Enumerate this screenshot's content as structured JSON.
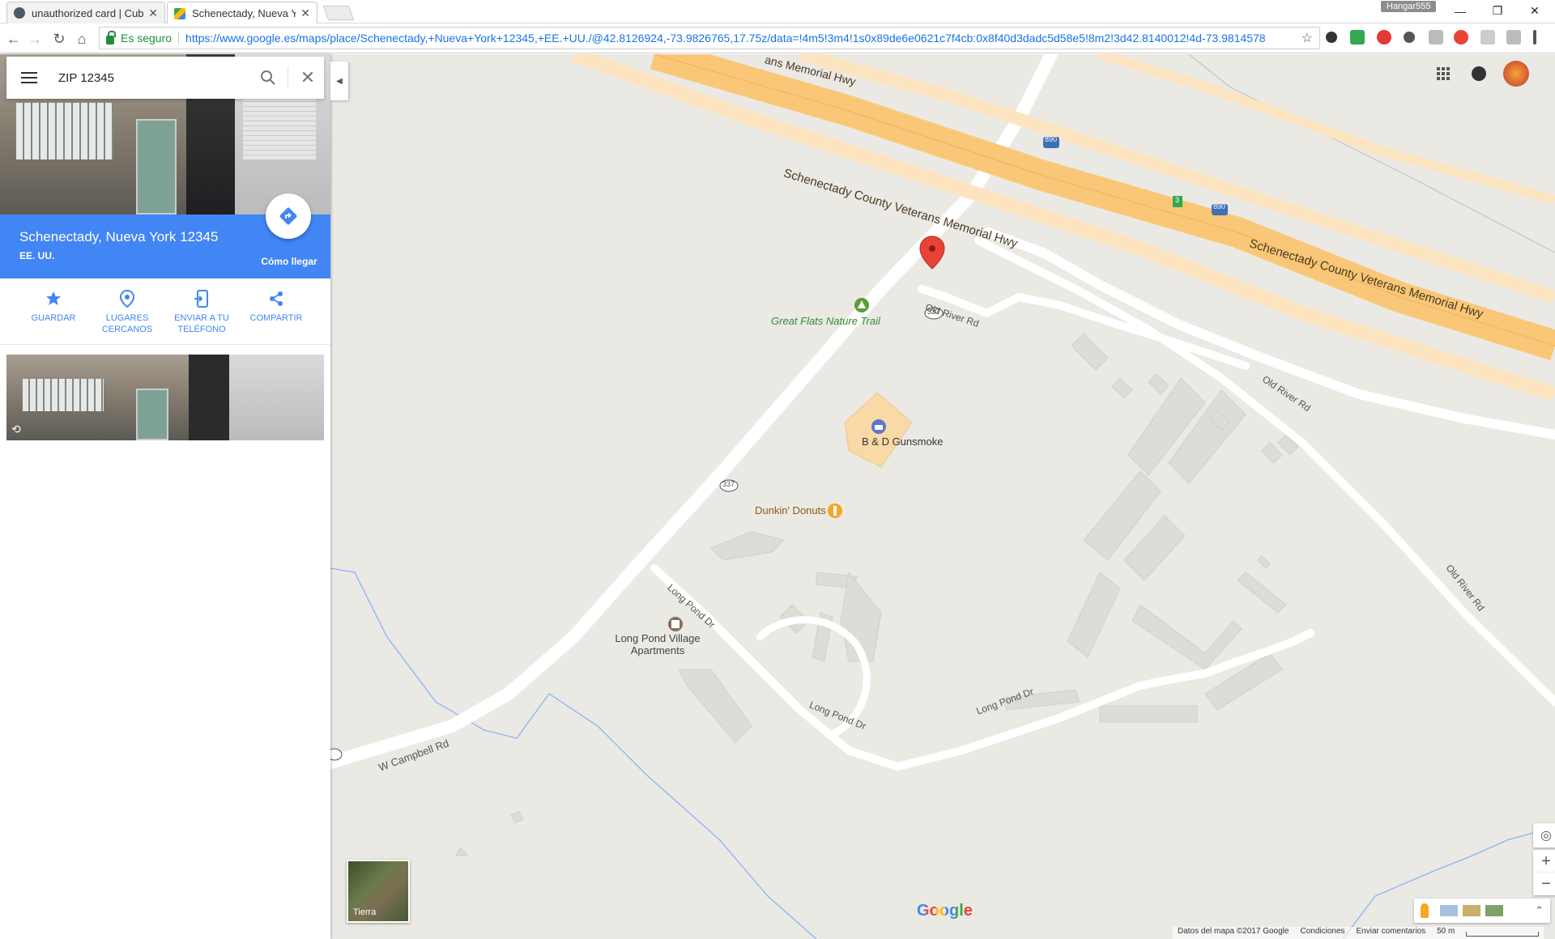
{
  "browser": {
    "tabs": [
      {
        "title": "unauthorized card | Cub",
        "active": false
      },
      {
        "title": "Schenectady, Nueva York",
        "active": true
      }
    ],
    "profile_name": "Hangar555",
    "secure_label": "Es seguro",
    "url": "https://www.google.es/maps/place/Schenectady,+Nueva+York+12345,+EE.+UU./@42.8126924,-73.9826765,17.75z/data=!4m5!3m4!1s0x89de6e0621c7f4cb:0x8f40d3dadc5d58e5!8m2!3d42.8140012!4d-73.9814578"
  },
  "search": {
    "query": "ZIP 12345"
  },
  "place": {
    "name": "Schenectady, Nueva York 12345",
    "country": "EE. UU.",
    "directions_label": "Cómo llegar"
  },
  "actions": [
    {
      "label": "GUARDAR",
      "icon": "star-icon"
    },
    {
      "label": "LUGARES CERCANOS",
      "icon": "nearby-pin-icon"
    },
    {
      "label": "ENVIAR A TU TELÉFONO",
      "icon": "send-to-phone-icon"
    },
    {
      "label": "COMPARTIR",
      "icon": "share-icon"
    }
  ],
  "map": {
    "labels": {
      "hwy1": "Schenectady County Veterans Memorial Hwy",
      "hwy2": "Schenectady County Veterans Memorial Hwy",
      "hwy_top": "ans Memorial Hwy",
      "great_flats": "Great Flats Nature Trail",
      "gunsmoke": "B & D Gunsmoke",
      "dunkin": "Dunkin' Donuts",
      "long_pond_village": "Long Pond Village Apartments",
      "old_river_1": "Old River Rd",
      "old_river_2": "Old River Rd",
      "old_river_3": "Old River Rd",
      "long_pond_1": "Long Pond Dr",
      "long_pond_2": "Long Pond Dr",
      "long_pond_3": "Long Pond Dr",
      "campbell": "W Campbell Rd",
      "route_337": "337",
      "i890": "890",
      "exit3": "3"
    },
    "layer_label": "Tierra",
    "logo": "Google",
    "footer": {
      "data": "Datos del mapa ©2017 Google",
      "terms": "Condiciones",
      "feedback": "Enviar comentarios",
      "scale": "50 m"
    }
  },
  "colors": {
    "accent_blue": "#4285f4",
    "map_bg": "#ebe9e4",
    "highway": "#f9c777",
    "pin": "#ea4335"
  }
}
